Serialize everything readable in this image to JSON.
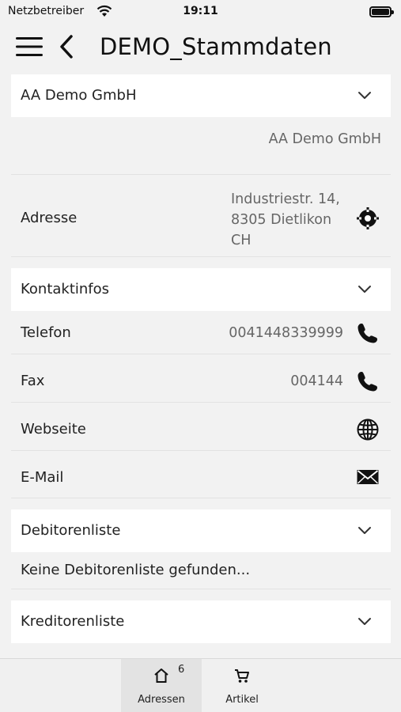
{
  "status_bar": {
    "carrier": "Netzbetreiber",
    "time": "19:11"
  },
  "nav": {
    "title": "DEMO_Stammdaten"
  },
  "company_section": {
    "header": "AA Demo GmbH",
    "name_value": "AA Demo GmbH"
  },
  "address": {
    "label": "Adresse",
    "line1": "Industriestr. 14,",
    "line2": "8305 Dietlikon",
    "line3": "CH"
  },
  "contact_section": {
    "header": "Kontaktinfos",
    "phone_label": "Telefon",
    "phone_value": "0041448339999",
    "fax_label": "Fax",
    "fax_value": "004144",
    "website_label": "Webseite",
    "email_label": "E-Mail"
  },
  "debitor_section": {
    "header": "Debitorenliste",
    "empty_text": "Keine Debitorenliste gefunden..."
  },
  "kreditor_section": {
    "header": "Kreditorenliste"
  },
  "tab_bar": {
    "tabs": [
      {
        "label": "Adressen",
        "badge": "6",
        "icon": "home-icon",
        "active": true
      },
      {
        "label": "Artikel",
        "icon": "cart-icon",
        "active": false
      }
    ]
  },
  "colors": {
    "background": "#f2f2f2",
    "card": "#ffffff",
    "text": "#222222",
    "secondary_text": "#666666"
  }
}
